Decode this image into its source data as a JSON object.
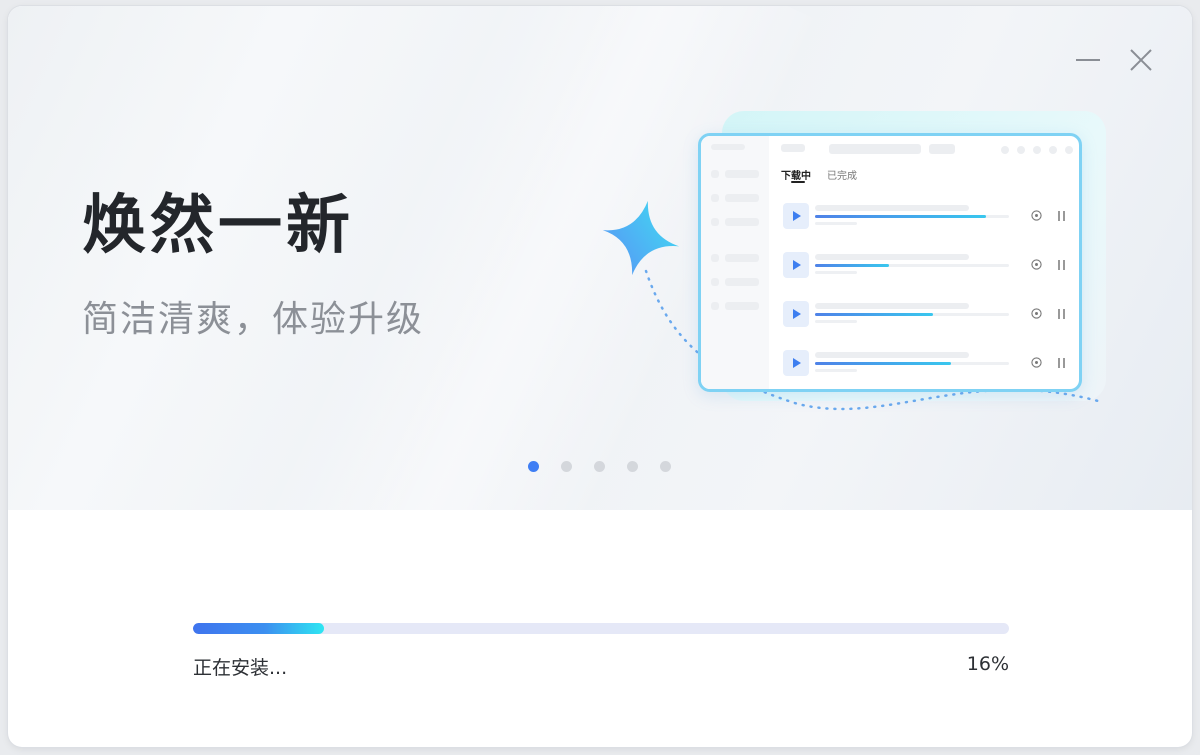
{
  "window": {
    "controls": {
      "minimize_icon": "minimize-icon",
      "close_icon": "close-icon"
    }
  },
  "hero": {
    "headline": "焕然一新",
    "subline": "简洁清爽，体验升级",
    "carousel": {
      "total_slides": 5,
      "active_index": 0
    }
  },
  "illustration": {
    "tabs": [
      "下载中",
      "已完成"
    ],
    "download_rows": [
      {
        "progress": 0.88
      },
      {
        "progress": 0.38
      },
      {
        "progress": 0.61
      },
      {
        "progress": 0.7
      }
    ],
    "colors": {
      "accent": "#3f7ef4",
      "accent_cyan": "#39c7ee",
      "sparkle_start": "#5a8ff5",
      "sparkle_end": "#3fe0f2"
    }
  },
  "install": {
    "status_text": "正在安装...",
    "percent_text": "16%",
    "progress": 0.16,
    "colors": {
      "fill_start": "#3f74ee",
      "fill_end": "#2ee6f2",
      "track": "#e5e8f7"
    }
  }
}
